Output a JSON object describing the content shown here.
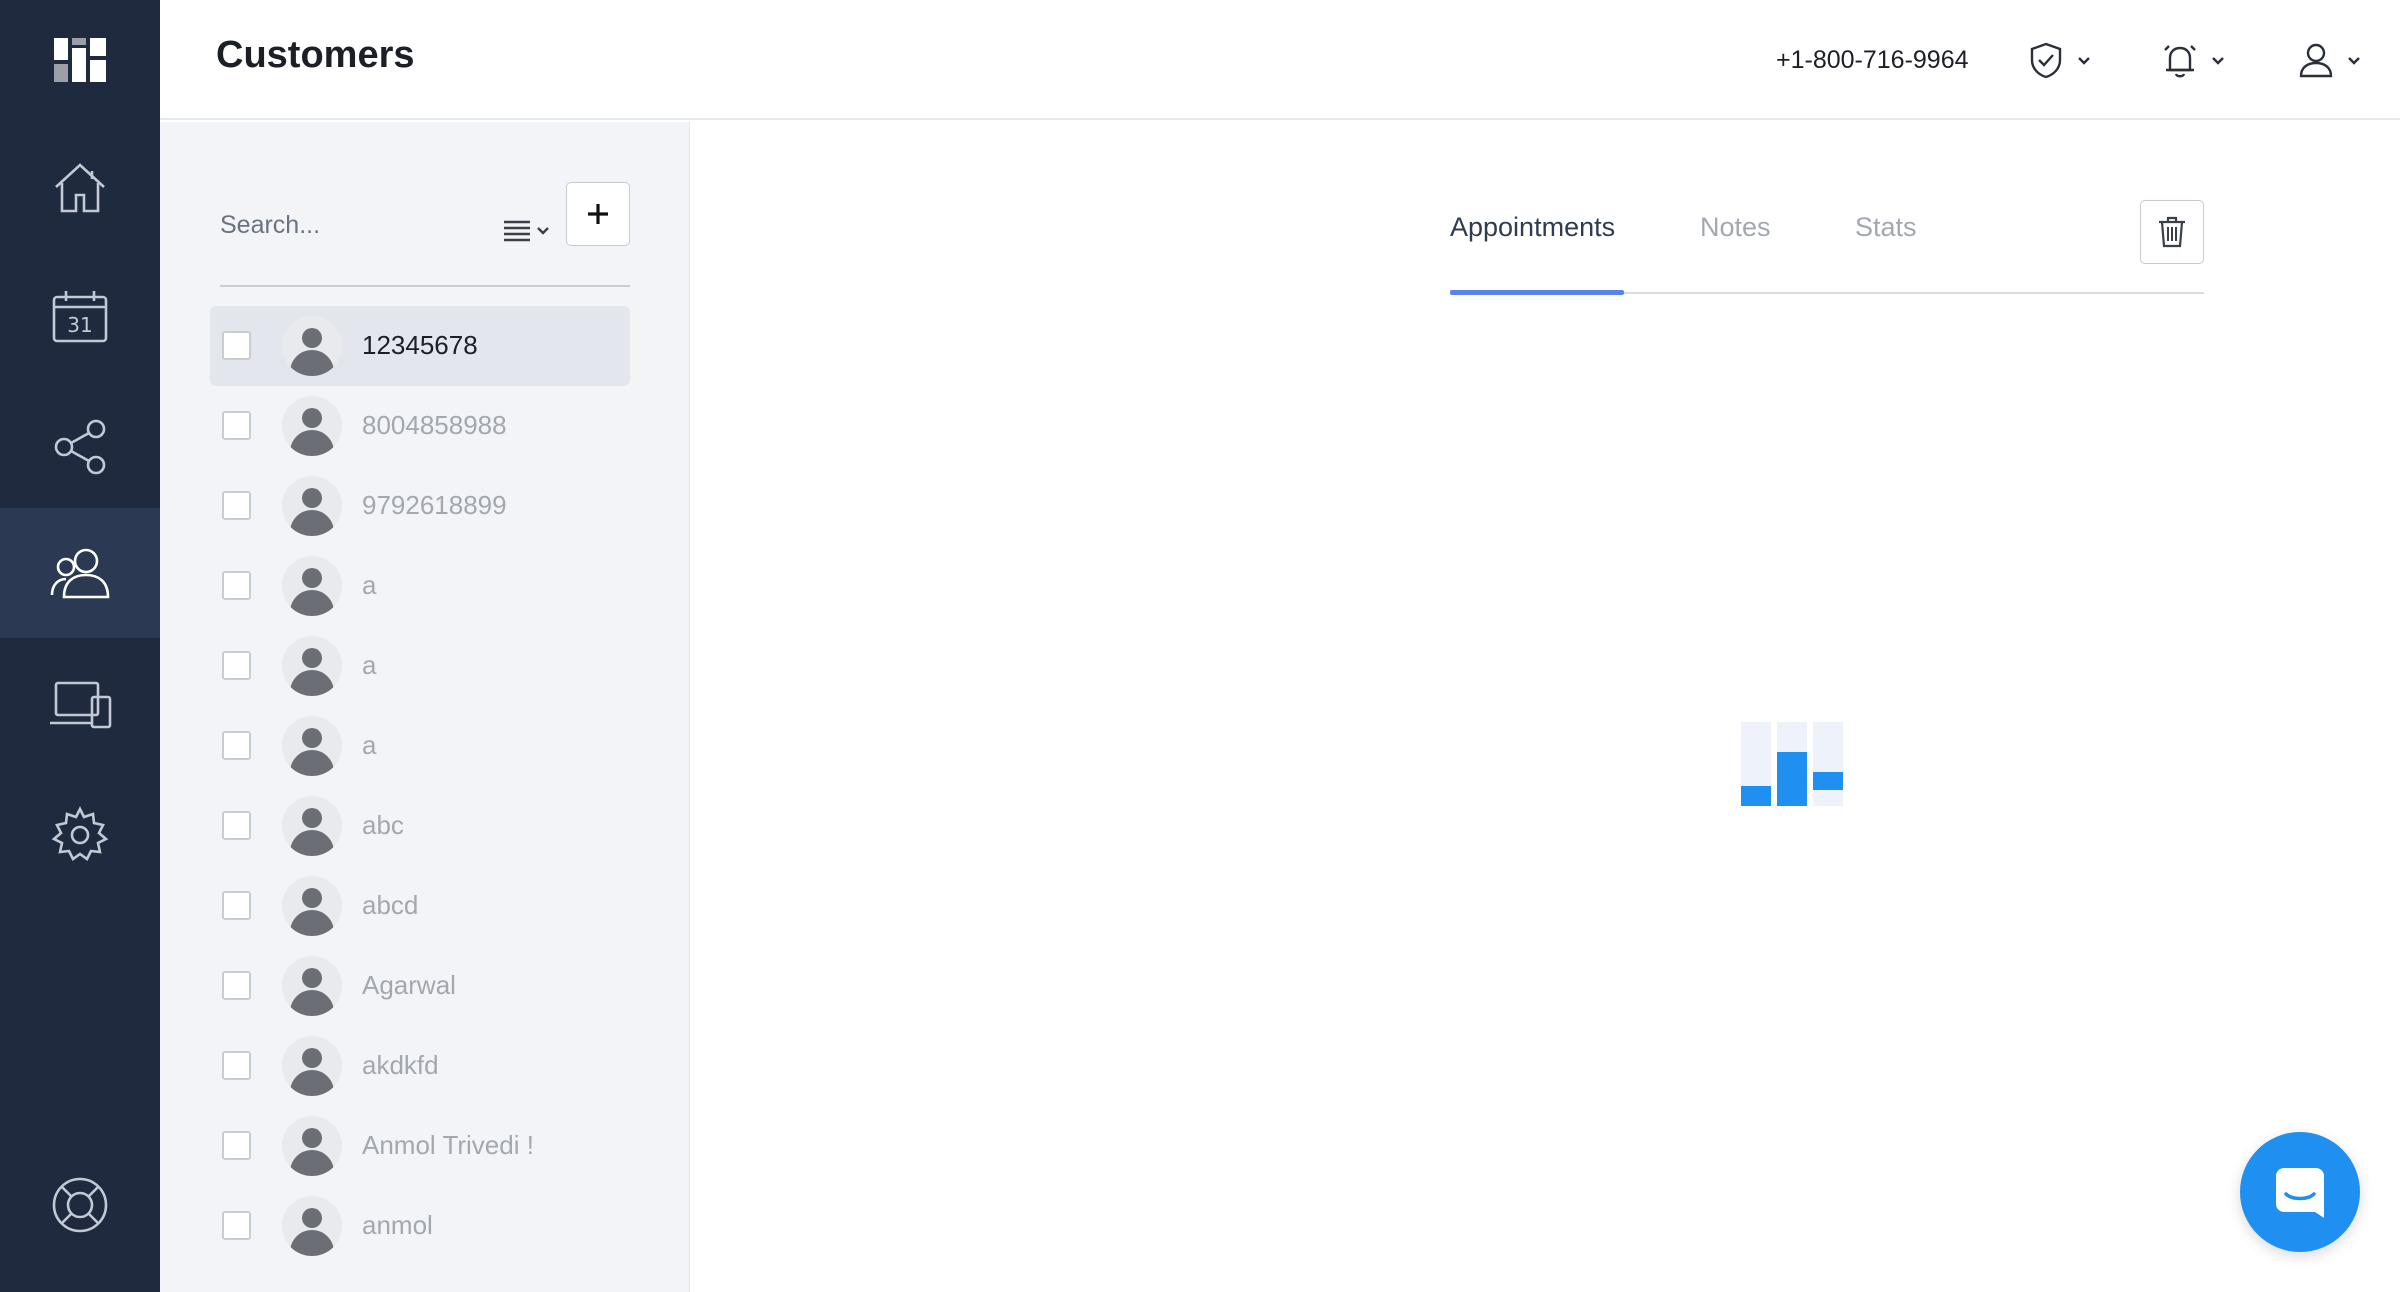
{
  "header": {
    "title": "Customers",
    "phone": "+1-800-716-9964"
  },
  "nav": {
    "items": [
      "home-icon",
      "calendar-icon",
      "share-icon",
      "customers-icon",
      "devices-icon",
      "settings-icon",
      "help-icon"
    ],
    "active": "customers-icon",
    "calendar_day": "31"
  },
  "list": {
    "search_placeholder": "Search...",
    "customers": [
      {
        "name": "12345678",
        "selected": true
      },
      {
        "name": "8004858988",
        "selected": false
      },
      {
        "name": "9792618899",
        "selected": false
      },
      {
        "name": "a",
        "selected": false
      },
      {
        "name": "a",
        "selected": false
      },
      {
        "name": "a",
        "selected": false
      },
      {
        "name": "abc",
        "selected": false
      },
      {
        "name": "abcd",
        "selected": false
      },
      {
        "name": "Agarwal",
        "selected": false
      },
      {
        "name": "akdkfd",
        "selected": false
      },
      {
        "name": "Anmol Trivedi !",
        "selected": false
      },
      {
        "name": "anmol",
        "selected": false
      }
    ]
  },
  "detail": {
    "tabs": [
      {
        "label": "Appointments",
        "active": true
      },
      {
        "label": "Notes",
        "active": false
      },
      {
        "label": "Stats",
        "active": false
      }
    ]
  },
  "colors": {
    "rail_bg": "#1f2a3f",
    "rail_active": "#2b3a52",
    "accent": "#1f8ff0",
    "tab_underline": "#5b83f0",
    "load_bar": "#f6a623"
  }
}
